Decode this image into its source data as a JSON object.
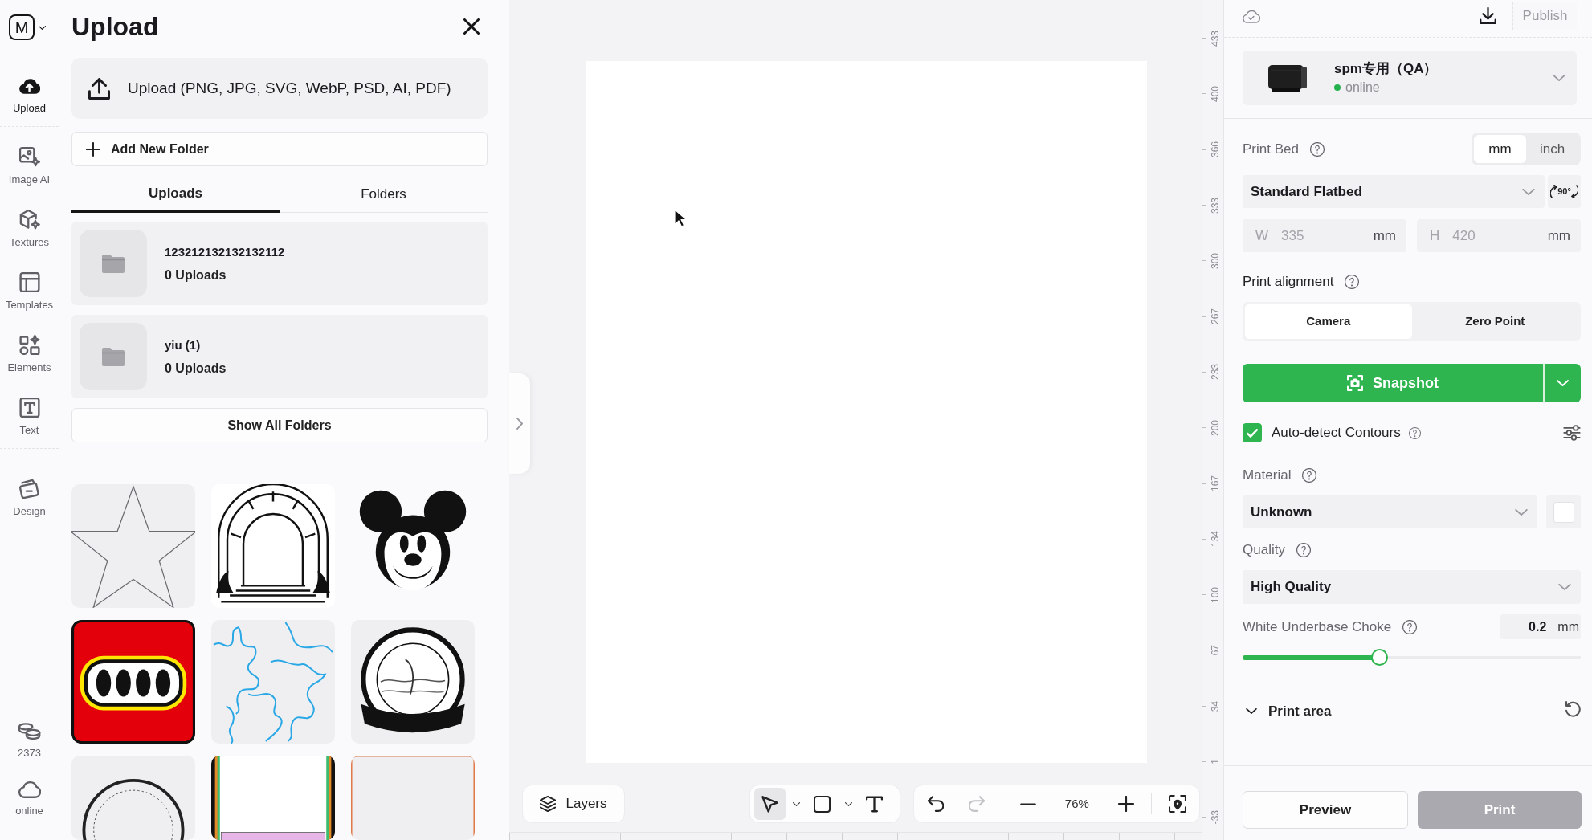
{
  "sidebar": {
    "logo": "M",
    "groups": [
      [
        {
          "kind": "upload",
          "label": "Upload",
          "selected": true
        }
      ],
      [
        {
          "kind": "image_ai",
          "label": "Image AI",
          "selected": false
        },
        {
          "kind": "textures",
          "label": "Textures",
          "selected": false
        },
        {
          "kind": "templates",
          "label": "Templates",
          "selected": false
        },
        {
          "kind": "elements",
          "label": "Elements",
          "selected": false
        },
        {
          "kind": "text",
          "label": "Text",
          "selected": false
        }
      ],
      [
        {
          "kind": "design",
          "label": "Design",
          "selected": false
        }
      ]
    ],
    "credits": "2373",
    "connection": "online"
  },
  "upload_panel": {
    "title": "Upload",
    "upload_button": "Upload (PNG, JPG, SVG, WebP, PSD, AI, PDF)",
    "new_folder_button": "Add New Folder",
    "tabs": [
      {
        "label": "Uploads",
        "selected": true
      },
      {
        "label": "Folders",
        "selected": false
      }
    ],
    "folders": [
      {
        "name": "123212132132132112",
        "count": "0 Uploads"
      },
      {
        "name": "yiu (1)",
        "count": "0 Uploads"
      }
    ],
    "show_all_button": "Show All Folders",
    "images": [
      {
        "kind": "star"
      },
      {
        "kind": "arch"
      },
      {
        "kind": "mouse"
      },
      {
        "kind": "logo"
      },
      {
        "kind": "dragon"
      },
      {
        "kind": "emblem"
      },
      {
        "kind": "monogram"
      },
      {
        "kind": "card"
      },
      {
        "kind": "frame"
      }
    ]
  },
  "canvas": {
    "layers_button": "Layers",
    "tools": [
      {
        "kind": "select",
        "selected": true
      },
      {
        "kind": "shape",
        "selected": false
      },
      {
        "kind": "text",
        "selected": false
      }
    ],
    "history": [
      {
        "kind": "undo",
        "disabled": false
      },
      {
        "kind": "redo",
        "disabled": true
      }
    ],
    "zoom": "76%",
    "ruler_labels": [
      "433",
      "400",
      "366",
      "333",
      "300",
      "267",
      "233",
      "200",
      "167",
      "134",
      "100",
      "67",
      "34",
      "1",
      "-33"
    ]
  },
  "print_panel": {
    "publish_button": {
      "label": "Publish",
      "disabled": true
    },
    "printer": {
      "name": "spm专用（QA）",
      "status": "online",
      "online": true
    },
    "print_bed": {
      "label": "Print Bed",
      "units": [
        {
          "label": "mm",
          "selected": true
        },
        {
          "label": "inch",
          "selected": false
        }
      ],
      "bed": "Standard Flatbed",
      "rotate_button": "90°",
      "width": {
        "label": "W",
        "value": "335",
        "unit": "mm",
        "disabled": true
      },
      "height": {
        "label": "H",
        "value": "420",
        "unit": "mm",
        "disabled": true
      }
    },
    "alignment": {
      "label": "Print alignment",
      "options": [
        {
          "label": "Camera",
          "selected": true
        },
        {
          "label": "Zero Point",
          "selected": false
        }
      ]
    },
    "snapshot_button": "Snapshot",
    "auto_detect": {
      "label": "Auto-detect Contours",
      "checked": true
    },
    "material": {
      "label": "Material",
      "value": "Unknown"
    },
    "quality": {
      "label": "Quality",
      "value": "High Quality"
    },
    "choke": {
      "label": "White Underbase Choke",
      "value": "0.2",
      "unit": "mm",
      "level": 0.4
    },
    "print_area": {
      "label": "Print area"
    },
    "preview_button": "Preview",
    "print_button": {
      "label": "Print",
      "disabled": true
    }
  }
}
